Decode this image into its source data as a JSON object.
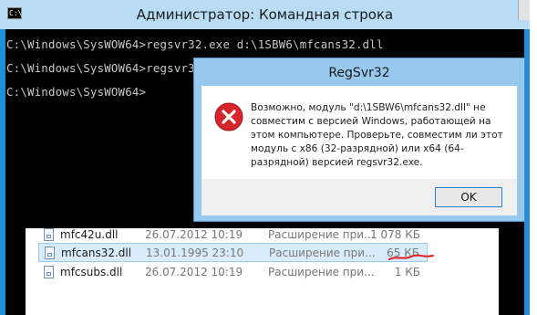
{
  "console": {
    "title": "Администратор: Командная строка",
    "icon": "cmd-icon",
    "icon_text": "C:\\",
    "lines": [
      "C:\\Windows\\SysWOW64>regsvr32.exe d:\\1SBW6\\mfcans32.dll",
      "C:\\Windows\\SysWOW64>regsvr32",
      "C:\\Windows\\SysWOW64>"
    ]
  },
  "dialog": {
    "title": "RegSvr32",
    "icon": "error-icon",
    "message": "Возможно, модуль \"d:\\1SBW6\\mfcans32.dll\" не совместим с версией Windows, работающей на этом компьютере. Проверьте, совместим ли этот модуль с x86 (32-разрядной) или x64 (64-разрядной) версией regsvr32.exe.",
    "ok_label": "OK"
  },
  "explorer": {
    "rows": [
      {
        "name": "mfc42u.dll",
        "date": "26.07.2012 10:19",
        "type": "Расширение при...",
        "size": "1 078 КБ",
        "selected": false
      },
      {
        "name": "mfcans32.dll",
        "date": "13.01.1995 23:10",
        "type": "Расширение при...",
        "size": "65 КБ",
        "selected": true
      },
      {
        "name": "mfcsubs.dll",
        "date": "26.07.2012 10:19",
        "type": "Расширение при...",
        "size": "1 КБ",
        "selected": false
      }
    ]
  },
  "colors": {
    "console_bg": "#000000",
    "console_text": "#c8c8c8",
    "titlebar": "#b9dcf5",
    "dialog_frame": "#97c9ee",
    "error_red": "#d6262c",
    "annotation_red": "#e02020",
    "selection": "#d9ecfb"
  }
}
